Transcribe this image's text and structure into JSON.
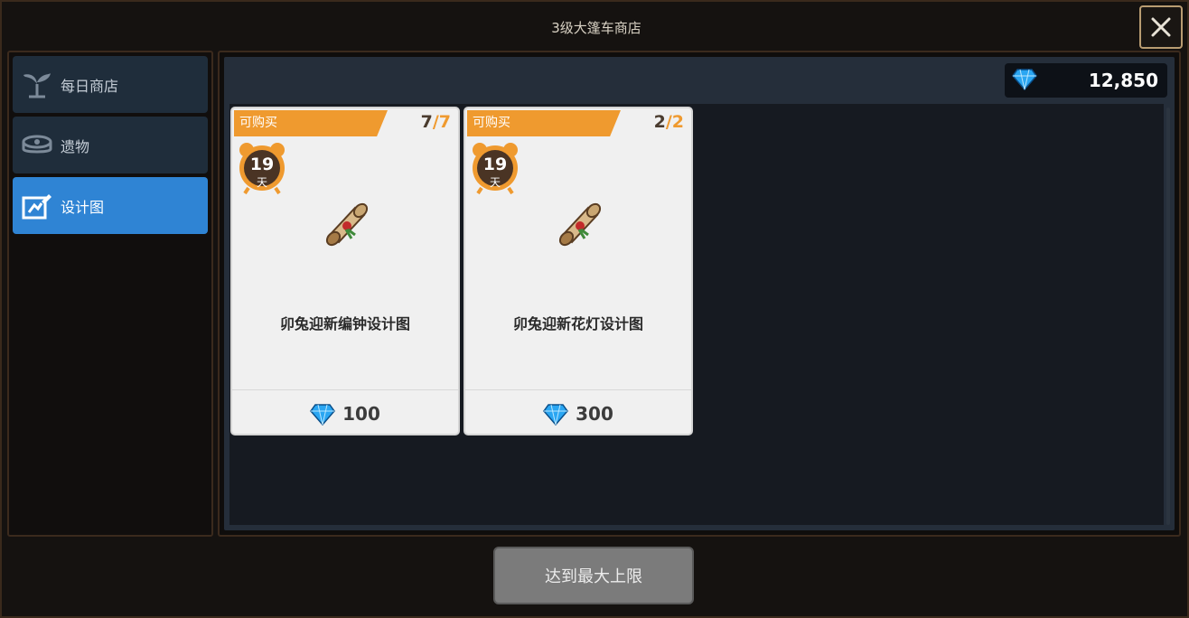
{
  "window": {
    "title": "3级大篷车商店"
  },
  "sidebar": {
    "items": [
      {
        "label": "每日商店",
        "icon": "sprout-icon",
        "active": false
      },
      {
        "label": "遗物",
        "icon": "relic-icon",
        "active": false
      },
      {
        "label": "设计图",
        "icon": "blueprint-icon",
        "active": true
      }
    ]
  },
  "currency": {
    "icon": "diamond-icon",
    "amount": "12,850"
  },
  "cards": [
    {
      "tag": "可购买",
      "count_current": "7",
      "count_sep": "/",
      "count_max": "7",
      "timer_value": "19",
      "timer_unit": "天",
      "name": "卯兔迎新编钟设计图",
      "price": "100"
    },
    {
      "tag": "可购买",
      "count_current": "2",
      "count_sep": "/",
      "count_max": "2",
      "timer_value": "19",
      "timer_unit": "天",
      "name": "卯兔迎新花灯设计图",
      "price": "300"
    }
  ],
  "footer": {
    "button_label": "达到最大上限"
  },
  "colors": {
    "accent_orange": "#ef9a2f",
    "active_tab": "#2f84d4",
    "gem_blue": "#2aa6f2"
  }
}
